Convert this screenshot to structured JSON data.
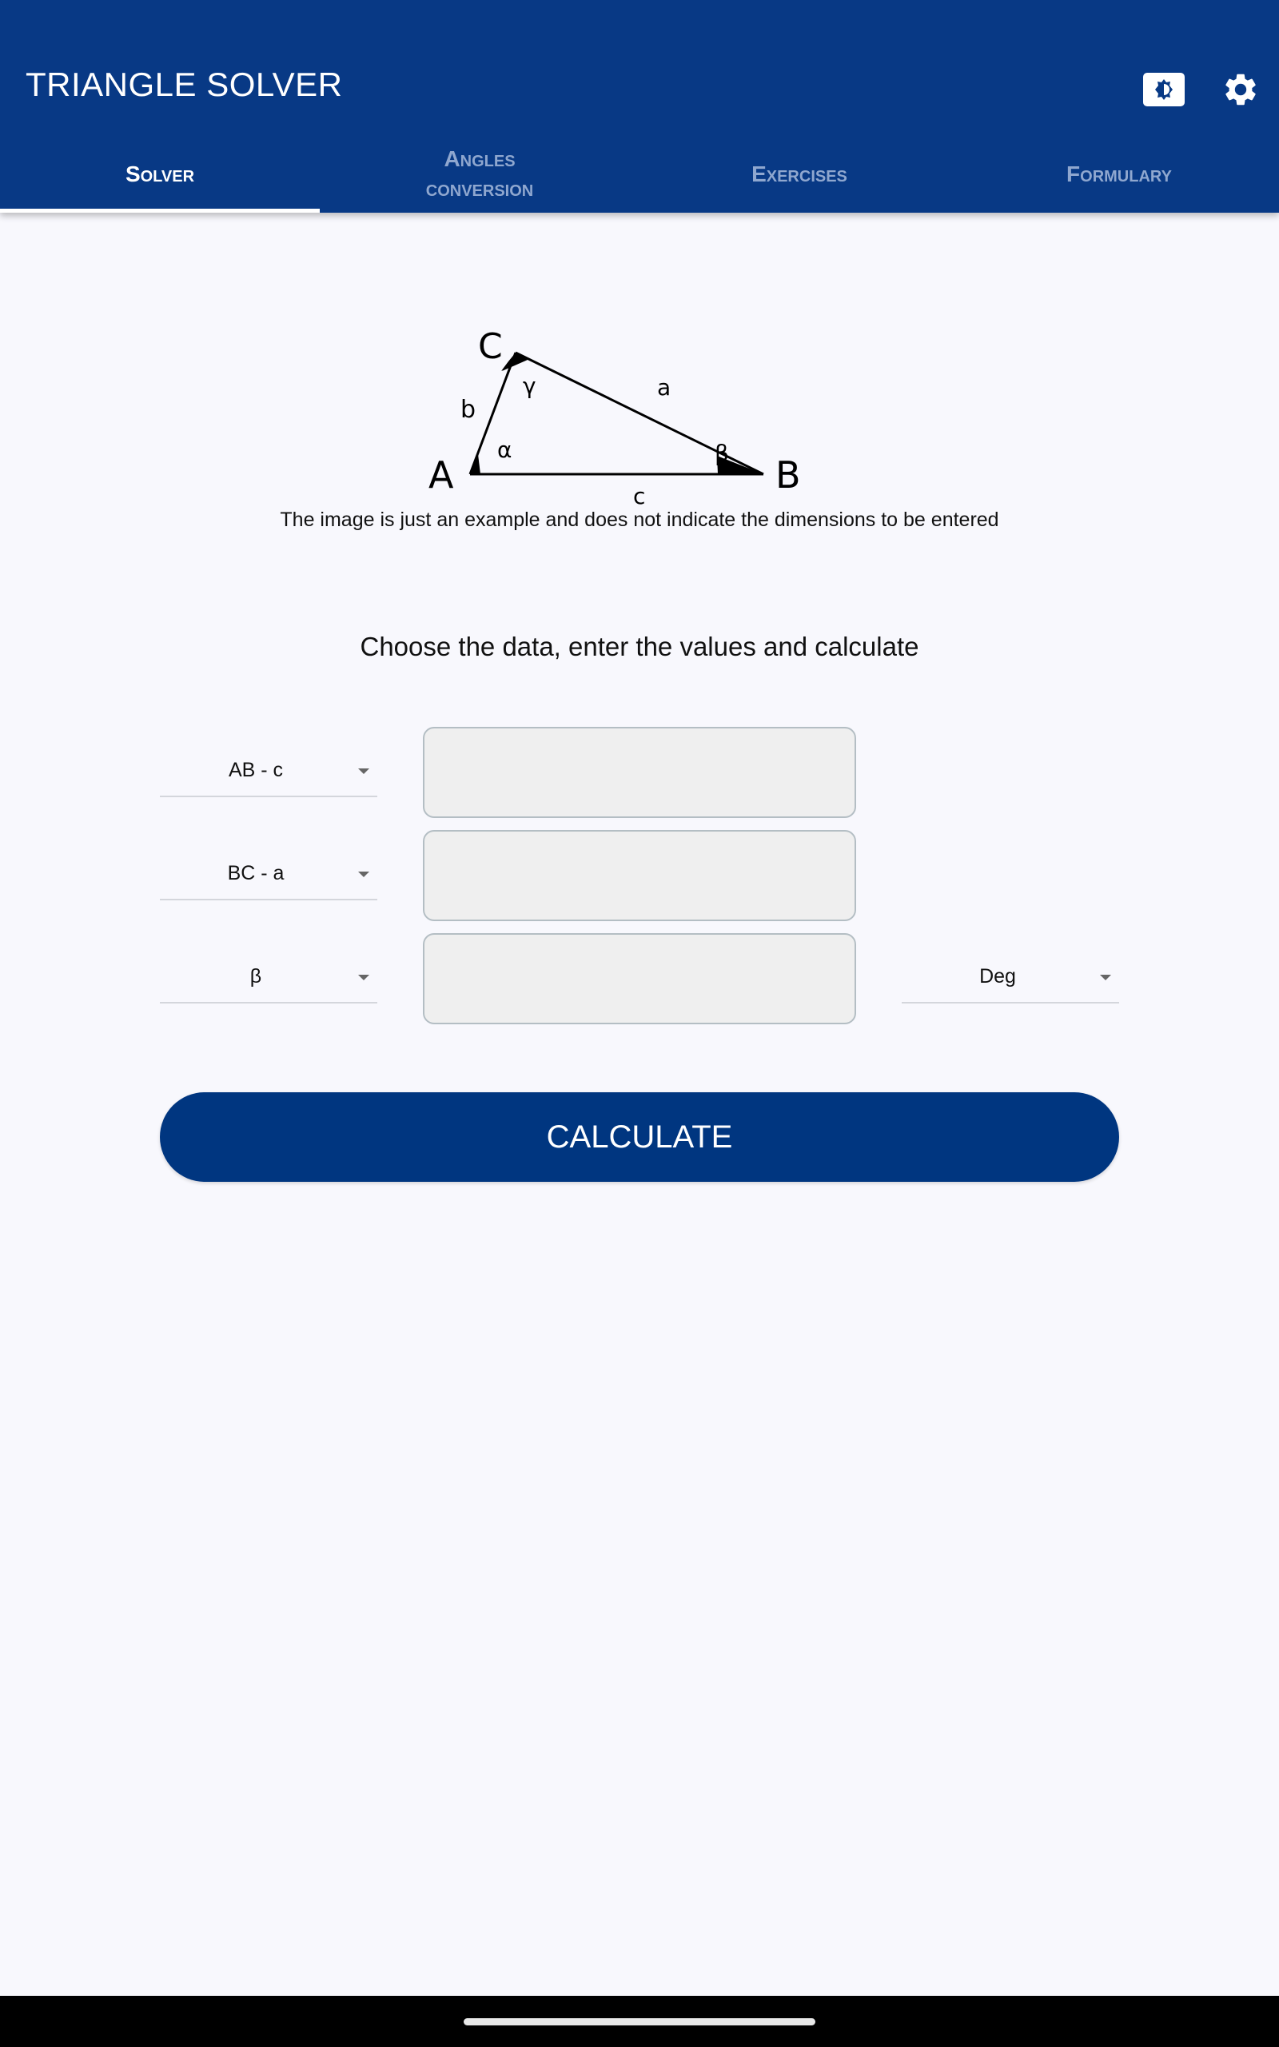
{
  "app": {
    "title": "TRIANGLE SOLVER",
    "icons": {
      "theme": "brightness-contrast-icon",
      "settings": "gear-icon"
    }
  },
  "tabs": [
    {
      "label": "Solver",
      "active": true
    },
    {
      "label": "Angles conversion",
      "active": false
    },
    {
      "label": "Exercises",
      "active": false
    },
    {
      "label": "Formulary",
      "active": false
    }
  ],
  "diagram": {
    "vertices": [
      "A",
      "B",
      "C"
    ],
    "sides": [
      "a",
      "b",
      "c"
    ],
    "angles": [
      "α",
      "β",
      "γ"
    ]
  },
  "caption": "The image is just an example and does not indicate the dimensions to be entered",
  "instructions": "Choose the data, enter the values and calculate",
  "form": {
    "rows": [
      {
        "data_select": "AB - c",
        "value": "",
        "unit_select": null
      },
      {
        "data_select": "BC - a",
        "value": "",
        "unit_select": null
      },
      {
        "data_select": "β",
        "value": "",
        "unit_select": "Deg"
      }
    ]
  },
  "calculate_label": "CALCULATE",
  "colors": {
    "primary": "#083985",
    "button": "#003680",
    "background": "#f8f8fd",
    "tab_inactive": "#8fa7cf"
  }
}
